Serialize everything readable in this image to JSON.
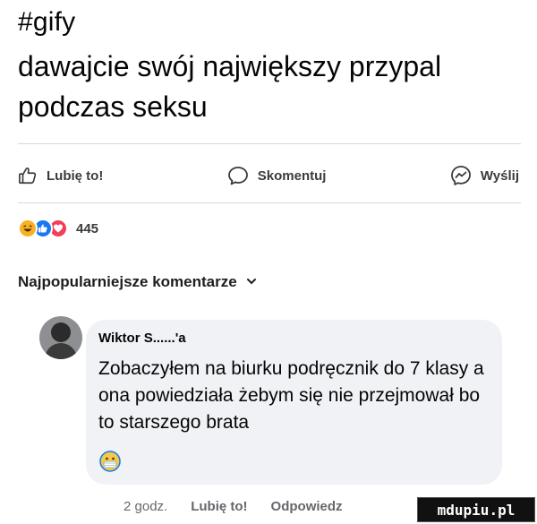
{
  "post": {
    "hashtag": "#gify",
    "text": "dawajcie swój największy przypal podczas seksu"
  },
  "actions": {
    "like": "Lubię to!",
    "comment": "Skomentuj",
    "send": "Wyślij"
  },
  "reactions": {
    "count": "445",
    "icons": [
      "haha-icon",
      "like-icon",
      "love-icon"
    ]
  },
  "comments_header": {
    "label": "Najpopularniejsze komentarze"
  },
  "comment": {
    "author": "Wiktor S......'a",
    "text": "Zobaczyłem na biurku podręcznik do 7 klasy a ona powiedziała żebym się nie przejmował bo to starszego brata",
    "emoji": "mask-face-emoji",
    "time": "2 godz.",
    "like": "Lubię to!",
    "reply": "Odpowiedz"
  },
  "watermark": "mdupiu.pl",
  "colors": {
    "like_blue": "#1877f2",
    "love_red": "#f33e58",
    "haha_yellow": "#f7b125",
    "bubble_bg": "#f0f2f5",
    "meta_gray": "#65676b"
  }
}
